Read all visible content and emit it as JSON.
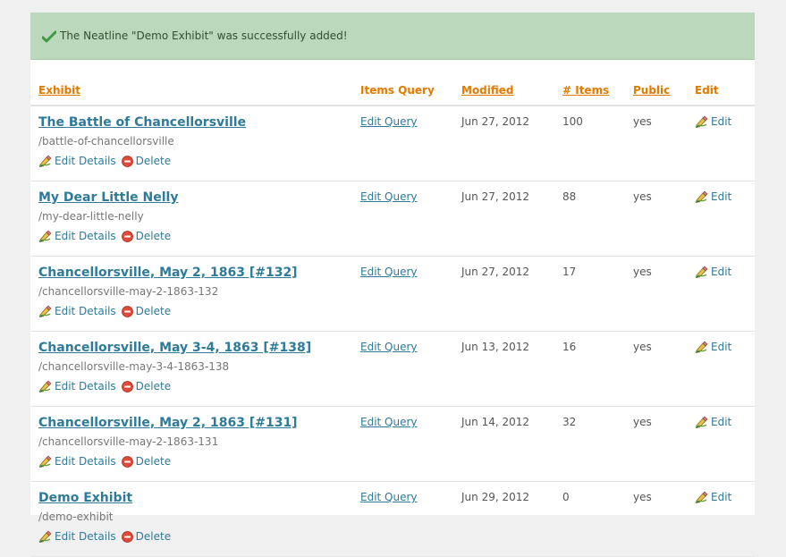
{
  "flash": {
    "message": "The Neatline \"Demo Exhibit\" was successfully added!"
  },
  "table": {
    "headers": {
      "exhibit": "Exhibit",
      "items_query": "Items Query",
      "modified": "Modified",
      "items": "# Items",
      "public": "Public",
      "edit": "Edit"
    },
    "rows": [
      {
        "title": "The Battle of Chancellorsville",
        "slug": "/battle-of-chancellorsville",
        "edit_details": "Edit Details",
        "delete": "Delete",
        "query": "Edit Query",
        "modified": "Jun 27, 2012",
        "items": "100",
        "public": "yes",
        "edit": "Edit"
      },
      {
        "title": "My Dear Little Nelly",
        "slug": "/my-dear-little-nelly",
        "edit_details": "Edit Details",
        "delete": "Delete",
        "query": "Edit Query",
        "modified": "Jun 27, 2012",
        "items": "88",
        "public": "yes",
        "edit": "Edit"
      },
      {
        "title": "Chancellorsville, May 2, 1863 [#132]",
        "slug": "/chancellorsville-may-2-1863-132",
        "edit_details": "Edit Details",
        "delete": "Delete",
        "query": "Edit Query",
        "modified": "Jun 27, 2012",
        "items": "17",
        "public": "yes",
        "edit": "Edit"
      },
      {
        "title": "Chancellorsville, May 3-4, 1863 [#138]",
        "slug": "/chancellorsville-may-3-4-1863-138",
        "edit_details": "Edit Details",
        "delete": "Delete",
        "query": "Edit Query",
        "modified": "Jun 13, 2012",
        "items": "16",
        "public": "yes",
        "edit": "Edit"
      },
      {
        "title": "Chancellorsville, May 2, 1863 [#131]",
        "slug": "/chancellorsville-may-2-1863-131",
        "edit_details": "Edit Details",
        "delete": "Delete",
        "query": "Edit Query",
        "modified": "Jun 14, 2012",
        "items": "32",
        "public": "yes",
        "edit": "Edit"
      },
      {
        "title": "Demo Exhibit",
        "slug": "/demo-exhibit",
        "edit_details": "Edit Details",
        "delete": "Delete",
        "query": "Edit Query",
        "modified": "Jun 29, 2012",
        "items": "0",
        "public": "yes",
        "edit": "Edit"
      }
    ]
  },
  "colors": {
    "accent_header": "#e07b00",
    "link": "#2e7a9a",
    "flash_bg": "#bcd8bc"
  }
}
